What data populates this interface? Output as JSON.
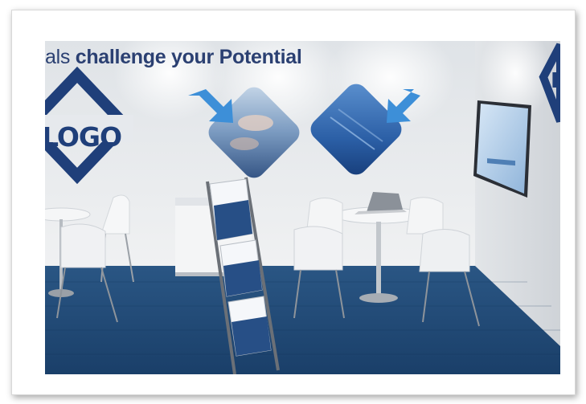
{
  "wall_text": {
    "regular": "als ",
    "bold": "challenge your Potential"
  },
  "logo_left": "LOGO",
  "logo_right": "LO",
  "colors": {
    "wall": "#e9ecef",
    "carpet": "#1f4a78",
    "brand_blue": "#1f3f7a",
    "arrow_blue": "#3d8fd8"
  },
  "icons": [
    "arrow-down-right-icon",
    "arrow-down-left-icon"
  ]
}
